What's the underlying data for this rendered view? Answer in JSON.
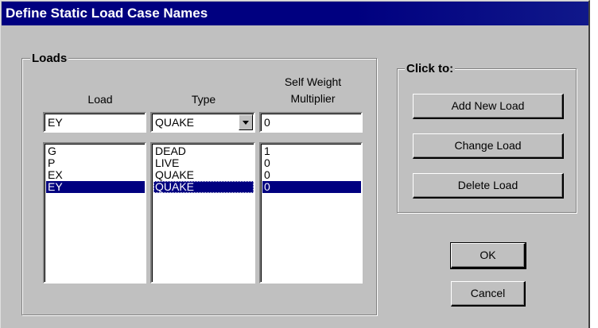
{
  "window": {
    "title": "Define Static Load Case Names"
  },
  "loads": {
    "group_label": "Loads",
    "columns": {
      "load": "Load",
      "type": "Type",
      "multiplier_line1": "Self Weight",
      "multiplier_line2": "Multiplier"
    },
    "input": {
      "load": "EY",
      "type": "QUAKE",
      "multiplier": "0"
    },
    "rows": [
      {
        "load": "G",
        "type": "DEAD",
        "multiplier": "1"
      },
      {
        "load": "P",
        "type": "LIVE",
        "multiplier": "0"
      },
      {
        "load": "EX",
        "type": "QUAKE",
        "multiplier": "0"
      },
      {
        "load": "EY",
        "type": "QUAKE",
        "multiplier": "0"
      }
    ],
    "selected_row": 3
  },
  "actions": {
    "group_label": "Click to:",
    "add_new_load": "Add New Load",
    "change_load": "Change Load",
    "delete_load": "Delete Load"
  },
  "dialog": {
    "ok": "OK",
    "cancel": "Cancel"
  },
  "colors": {
    "title_bar": "#000080",
    "face": "#c0c0c0",
    "selection": "#000080"
  }
}
